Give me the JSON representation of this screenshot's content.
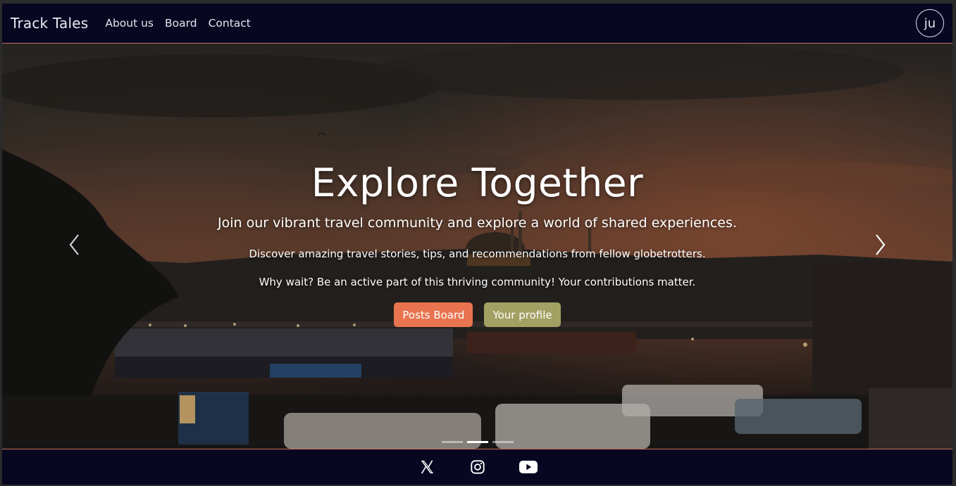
{
  "navbar": {
    "brand": "Track Tales",
    "links": [
      "About us",
      "Board",
      "Contact"
    ],
    "avatar_initials": "ju"
  },
  "hero": {
    "title": "Explore Together",
    "subtitle": "Join our vibrant travel community and explore a world of shared experiences.",
    "paragraph1": "Discover amazing travel stories, tips, and recommendations from fellow globetrotters.",
    "paragraph2": "Why wait? Be an active part of this thriving community! Your contributions matter.",
    "buttons": {
      "posts_board": "Posts Board",
      "your_profile": "Your profile"
    },
    "carousel": {
      "slides": 3,
      "active_index": 1
    }
  },
  "footer": {
    "social_icons": [
      "x-icon",
      "instagram-icon",
      "youtube-icon"
    ]
  },
  "colors": {
    "nav_bg": "#080722",
    "accent_border": "#c9715a",
    "button_orange": "#e8744f",
    "button_olive": "#a3a063"
  }
}
